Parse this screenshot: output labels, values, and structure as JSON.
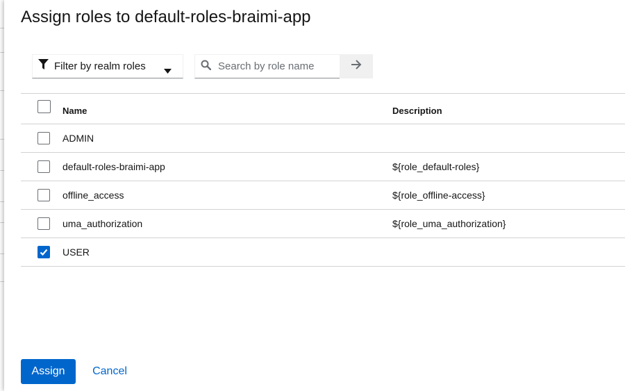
{
  "dialog": {
    "title": "Assign roles to default-roles-braimi-app"
  },
  "toolbar": {
    "filter_label": "Filter by realm roles",
    "filter_icon": "filter-icon",
    "caret_icon": "caret-down-icon",
    "search_icon": "search-icon",
    "search_placeholder": "Search by role name",
    "search_value": "",
    "go_icon": "arrow-right-icon"
  },
  "table": {
    "columns": {
      "name": "Name",
      "description": "Description"
    },
    "rows": [
      {
        "name": "ADMIN",
        "description": "",
        "checked": false
      },
      {
        "name": "default-roles-braimi-app",
        "description": "${role_default-roles}",
        "checked": false
      },
      {
        "name": "offline_access",
        "description": "${role_offline-access}",
        "checked": false
      },
      {
        "name": "uma_authorization",
        "description": "${role_uma_authorization}",
        "checked": false
      },
      {
        "name": "USER",
        "description": "",
        "checked": true
      }
    ]
  },
  "footer": {
    "assign_label": "Assign",
    "cancel_label": "Cancel"
  },
  "colors": {
    "primary": "#0066cc",
    "border": "#d2d2d2",
    "overlay": "#6a6e73"
  }
}
